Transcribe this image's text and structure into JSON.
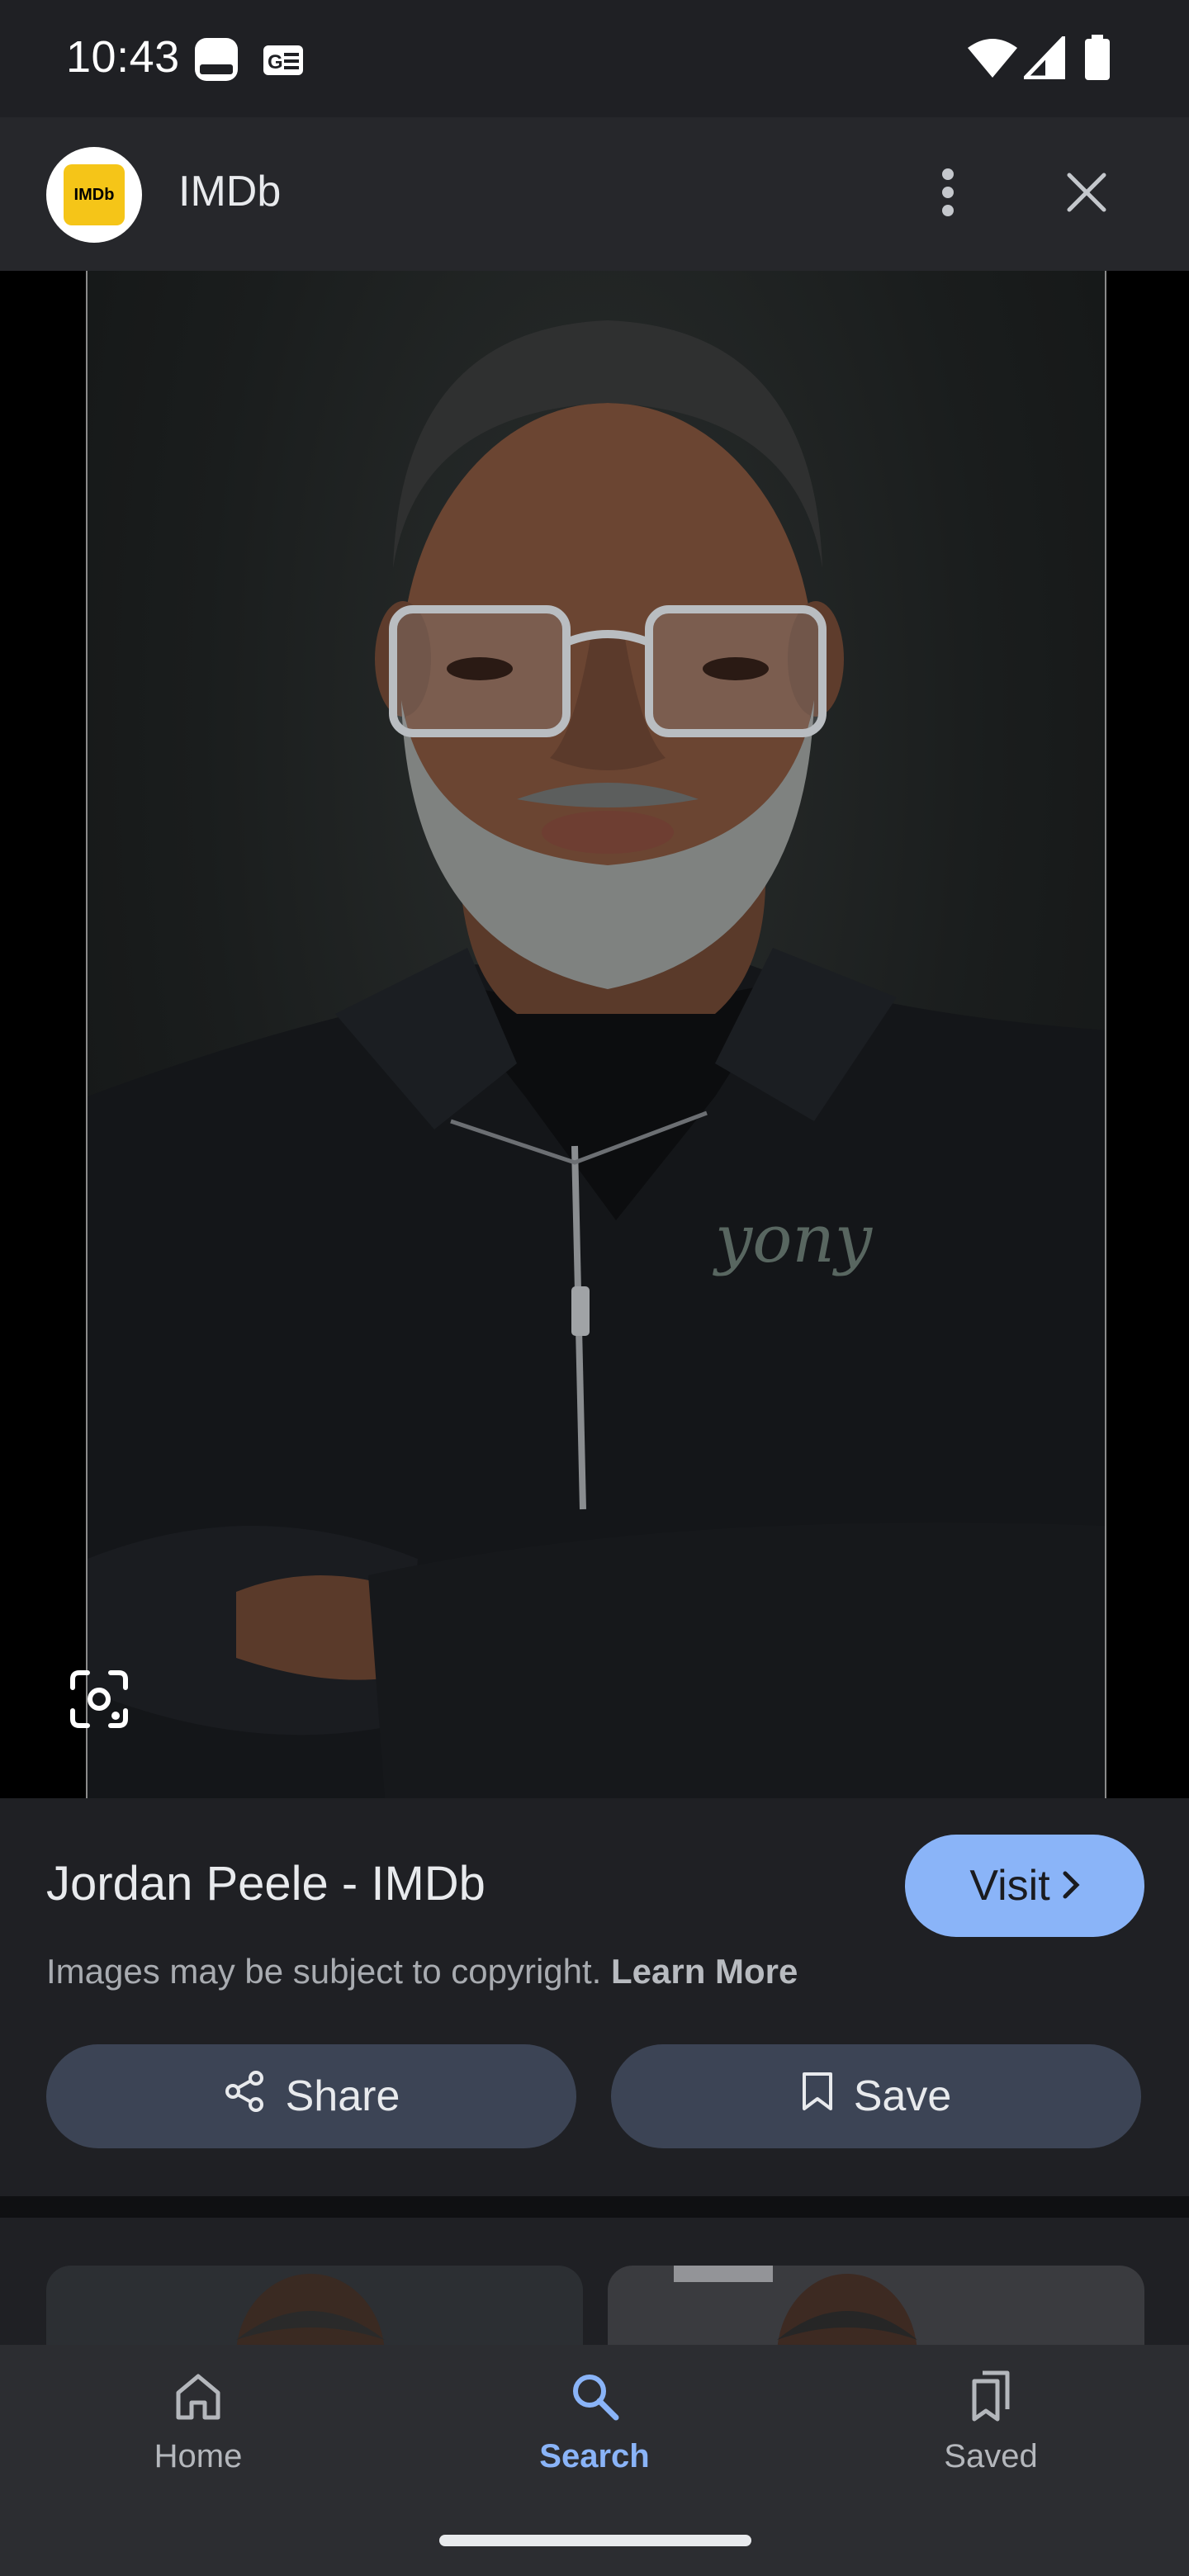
{
  "status_bar": {
    "time": "10:43",
    "icons": [
      "notification-app-icon",
      "news-icon",
      "wifi-icon",
      "signal-icon",
      "battery-icon"
    ]
  },
  "header": {
    "logo_text": "IMDb",
    "site_name": "IMDb",
    "icons": [
      "more-vert-icon",
      "close-icon"
    ]
  },
  "image": {
    "subject": "portrait photo",
    "lens_icon": "google-lens-icon"
  },
  "result": {
    "title": "Jordan Peele - IMDb",
    "visit_label": "Visit",
    "copyright_text": "Images may be subject to copyright.",
    "learn_more": "Learn More",
    "share_label": "Share",
    "save_label": "Save"
  },
  "bottom_nav": {
    "items": [
      {
        "label": "Home",
        "icon": "home-icon",
        "active": false
      },
      {
        "label": "Search",
        "icon": "search-icon",
        "active": true
      },
      {
        "label": "Saved",
        "icon": "saved-icon",
        "active": false
      }
    ]
  },
  "colors": {
    "accent": "#8ab4f8",
    "background": "#1f2024",
    "imdb_yellow": "#f5c518",
    "button_bg": "#3c4455"
  }
}
